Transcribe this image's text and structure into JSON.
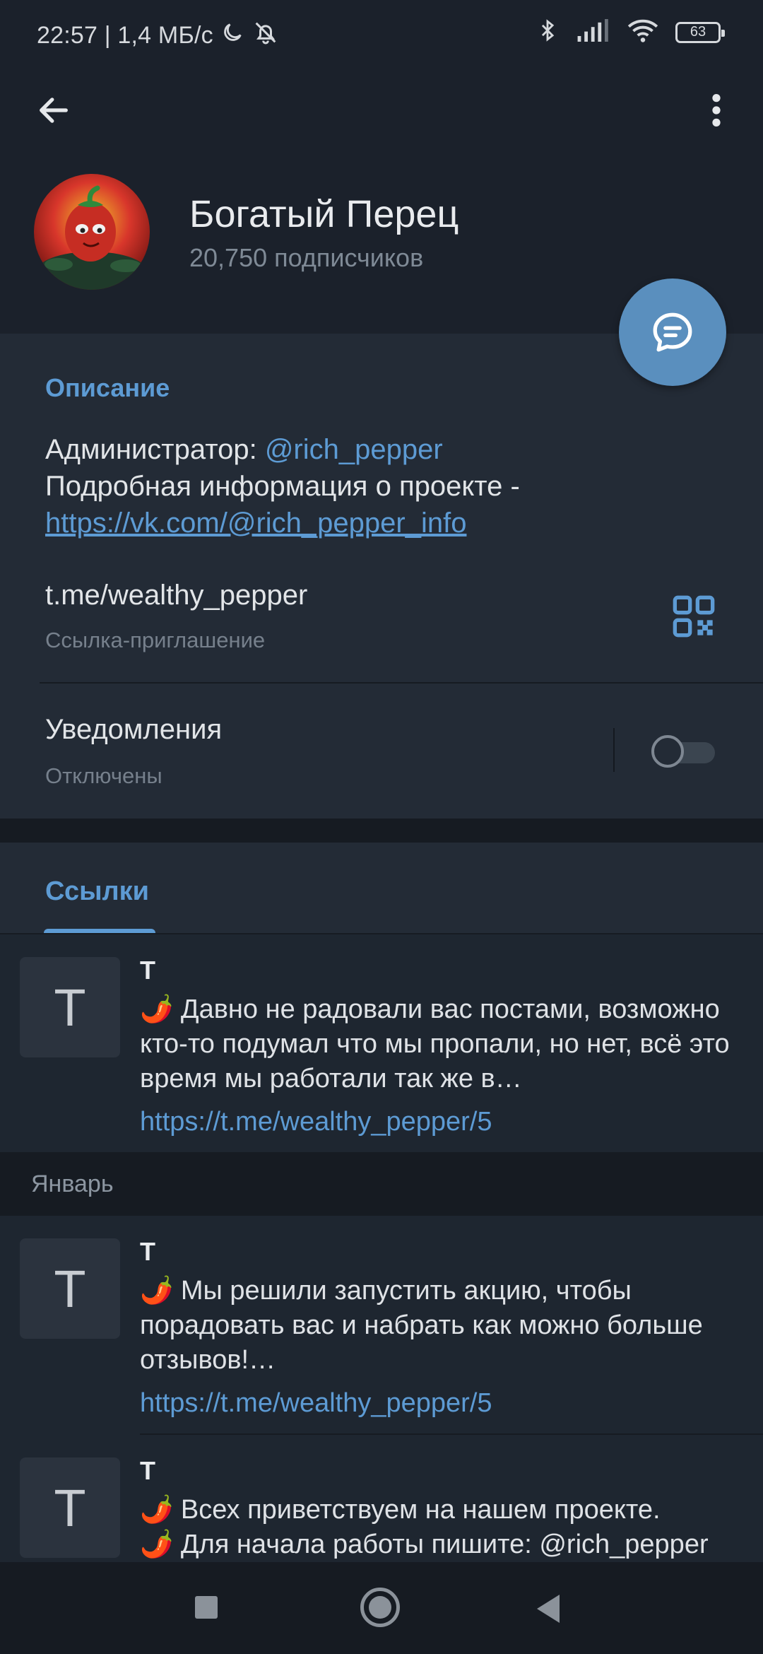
{
  "status_bar": {
    "time_speed": "22:57 | 1,4 МБ/с",
    "battery": "63",
    "icons": [
      "moon-icon",
      "alarm-off-icon",
      "bluetooth-icon",
      "signal-icon",
      "wifi-icon",
      "battery-icon"
    ]
  },
  "header": {
    "back_icon": "arrow-left-icon",
    "menu_icon": "more-vertical-icon",
    "title": "Богатый Перец",
    "subscribers": "20,750 подписчиков",
    "fab_icon": "chat-bubble-icon"
  },
  "info": {
    "description_title": "Описание",
    "admin_prefix": "Администратор: ",
    "admin_mention": "@rich_pepper",
    "details_text": "Подробная информация о проекте -",
    "details_link": "https://vk.com/@rich_pepper_info",
    "invite_link": "t.me/wealthy_pepper",
    "invite_label": "Ссылка-приглашение",
    "notifications_label": "Уведомления",
    "notifications_status": "Отключены",
    "notifications_enabled": false
  },
  "links": {
    "tab_label": "Ссылки",
    "month_label": "Январь",
    "items": [
      {
        "thumb_letter": "T",
        "letter": "T",
        "text": "🌶️ Давно не радовали вас постами, возможно кто-то подумал что мы пропали, но нет, всё это время мы работали так же в…",
        "url": "https://t.me/wealthy_pepper/5"
      },
      {
        "thumb_letter": "T",
        "letter": "T",
        "text": "🌶️ Мы решили запустить акцию, чтобы порадовать вас и набрать как можно больше отзывов!…",
        "url": "https://t.me/wealthy_pepper/5"
      },
      {
        "thumb_letter": "T",
        "letter": "T",
        "text": "🌶️ Всех приветствуем на нашем проекте.\n🌶️ Для начала работы пишите: @rich_pepper",
        "url": ""
      }
    ]
  },
  "colors": {
    "accent": "#5d9bd4",
    "fab": "#5a8fbe",
    "background": "#1b212b",
    "card": "#232b36"
  }
}
